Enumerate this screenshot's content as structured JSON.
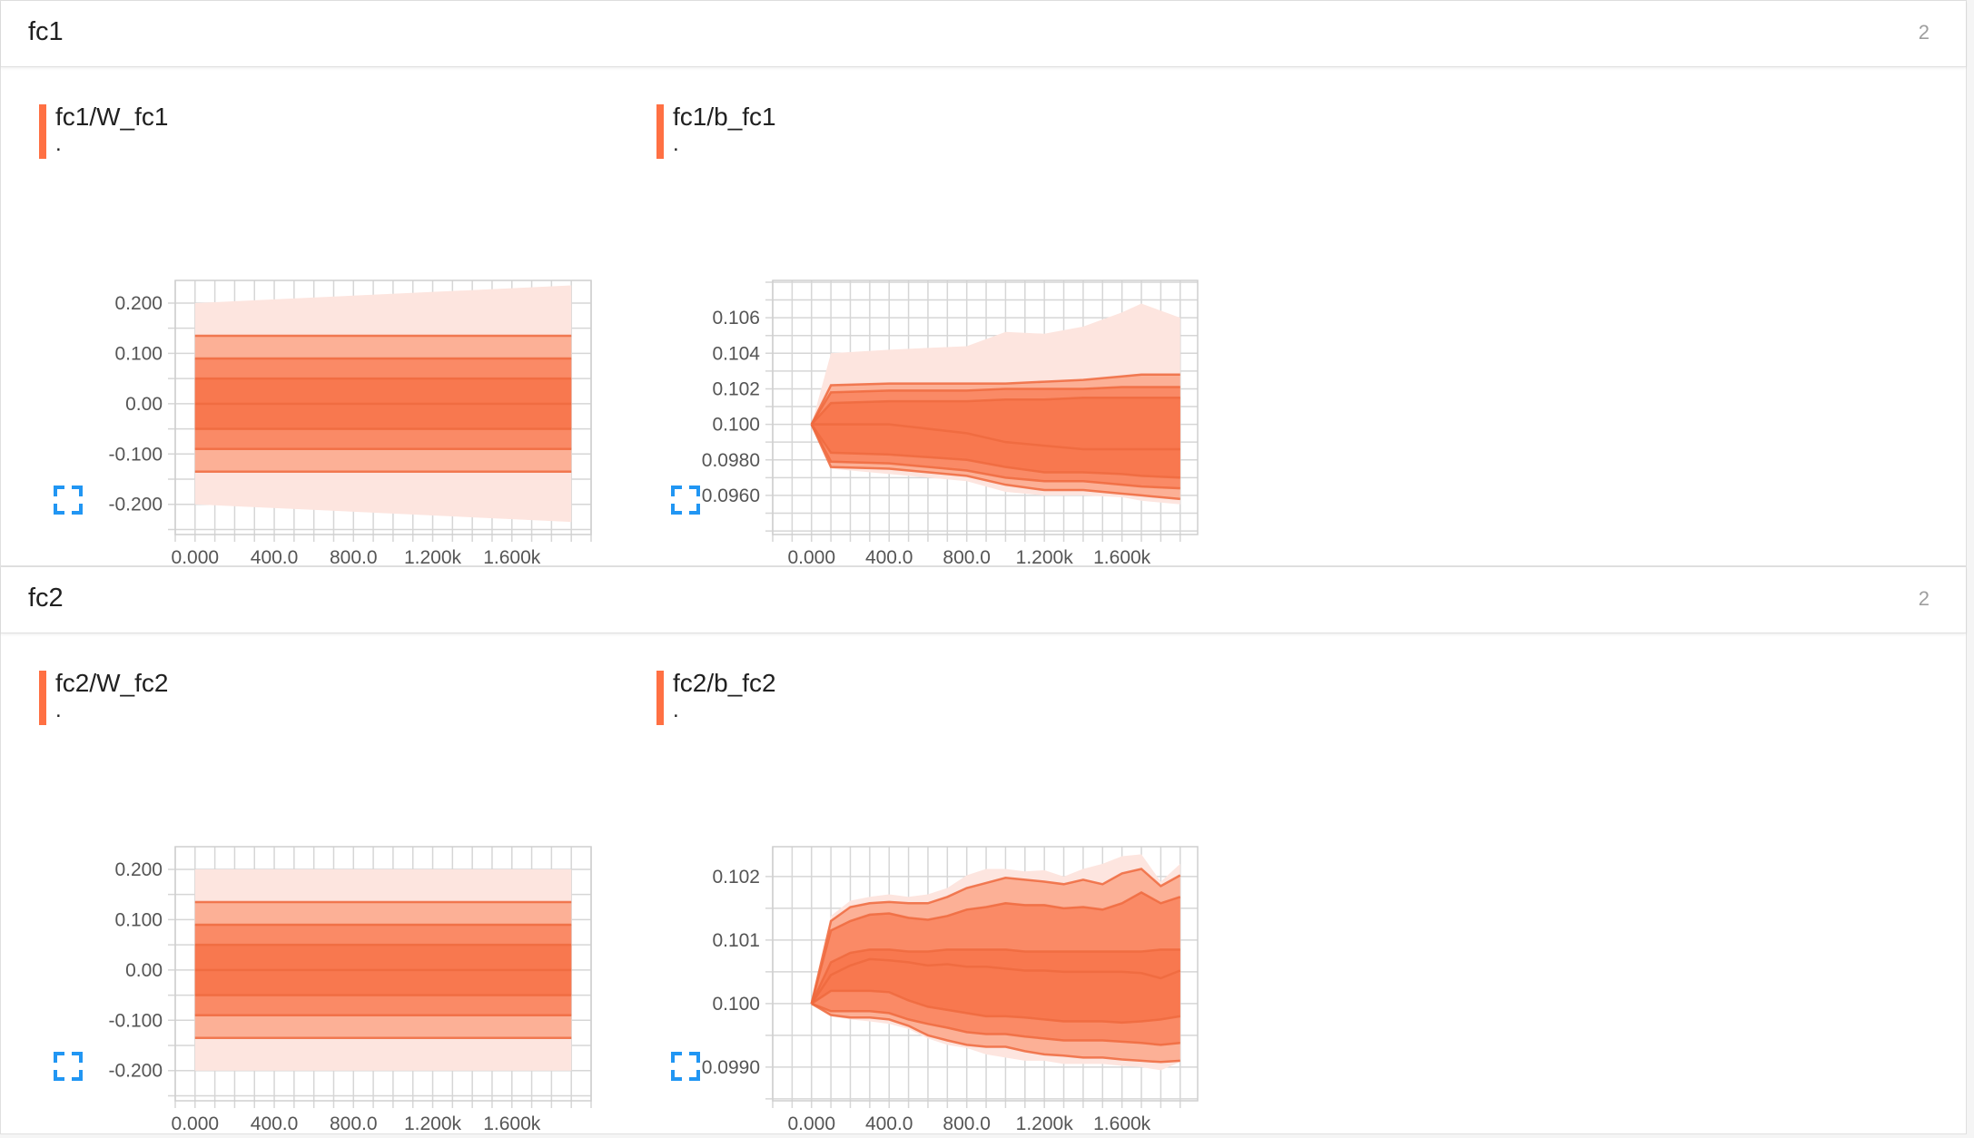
{
  "sections": [
    {
      "title": "fc1",
      "count": "2"
    },
    {
      "title": "fc2",
      "count": "2"
    }
  ],
  "colors": {
    "accent": "#ff7043",
    "band_outer": "#fde5df",
    "band_2": "#fcb096",
    "band_3": "#fa8a66",
    "band_inner": "#f8784f",
    "line": "#ef6a3e",
    "expand_icon": "#2196f3"
  },
  "icons": {
    "expand": "fullscreen-expand-icon"
  },
  "chart_data": [
    {
      "type": "area",
      "title": "fc1/W_fc1",
      "subtitle": ".",
      "ylim": [
        -0.26,
        0.245
      ],
      "xlim": [
        -100,
        2000
      ],
      "yticks": [
        0.2,
        0.1,
        0.0,
        -0.1,
        -0.2
      ],
      "ytick_labels": [
        "0.200",
        "0.100",
        "0.00",
        "-0.100",
        "-0.200"
      ],
      "xticks": [
        0,
        400,
        800,
        1200,
        1600
      ],
      "xtick_labels": [
        "0.000",
        "400.0",
        "800.0",
        "1.200k",
        "1.600k"
      ],
      "grid": true,
      "x": [
        0,
        1900
      ],
      "percentiles": [
        [
          -0.2,
          -0.235
        ],
        [
          -0.135,
          -0.135
        ],
        [
          -0.09,
          -0.09
        ],
        [
          -0.05,
          -0.05
        ],
        [
          0.0,
          0.0
        ],
        [
          0.05,
          0.05
        ],
        [
          0.09,
          0.09
        ],
        [
          0.135,
          0.135
        ],
        [
          0.2,
          0.235
        ]
      ]
    },
    {
      "type": "area",
      "title": "fc1/b_fc1",
      "subtitle": ".",
      "ylim": [
        0.0938,
        0.1081
      ],
      "xlim": [
        -200,
        1990
      ],
      "yticks": [
        0.106,
        0.104,
        0.102,
        0.1,
        0.098,
        0.096
      ],
      "ytick_labels": [
        "0.106",
        "0.104",
        "0.102",
        "0.100",
        "0.0980",
        "0.0960"
      ],
      "xticks": [
        0,
        400,
        800,
        1200,
        1600
      ],
      "xtick_labels": [
        "0.000",
        "400.0",
        "800.0",
        "1.200k",
        "1.600k"
      ],
      "grid": true,
      "x": [
        0,
        100,
        400,
        800,
        1000,
        1200,
        1400,
        1600,
        1700,
        1900
      ],
      "percentiles": [
        [
          0.1,
          0.0975,
          0.0972,
          0.0968,
          0.0962,
          0.096,
          0.096,
          0.0959,
          0.0957,
          0.0955
        ],
        [
          0.1,
          0.0976,
          0.0975,
          0.0971,
          0.0966,
          0.0963,
          0.0963,
          0.0961,
          0.096,
          0.0958
        ],
        [
          0.1,
          0.0979,
          0.0978,
          0.0974,
          0.097,
          0.0968,
          0.0968,
          0.0966,
          0.0965,
          0.0964
        ],
        [
          0.1,
          0.0984,
          0.0983,
          0.098,
          0.0976,
          0.0973,
          0.0973,
          0.0972,
          0.0971,
          0.097
        ],
        [
          0.1,
          0.1,
          0.1,
          0.0995,
          0.099,
          0.0988,
          0.0986,
          0.0986,
          0.0986,
          0.0986
        ],
        [
          0.1,
          0.1012,
          0.1013,
          0.1013,
          0.1014,
          0.1014,
          0.1015,
          0.1015,
          0.1015,
          0.1015
        ],
        [
          0.1,
          0.1018,
          0.1019,
          0.1019,
          0.102,
          0.102,
          0.102,
          0.1021,
          0.1021,
          0.1021
        ],
        [
          0.1,
          0.1022,
          0.1023,
          0.1023,
          0.1023,
          0.1024,
          0.1025,
          0.1027,
          0.1028,
          0.1028
        ],
        [
          0.1,
          0.104,
          0.1042,
          0.1044,
          0.1052,
          0.1051,
          0.1055,
          0.1063,
          0.1068,
          0.106
        ]
      ]
    },
    {
      "type": "area",
      "title": "fc2/W_fc2",
      "subtitle": ".",
      "ylim": [
        -0.26,
        0.245
      ],
      "xlim": [
        -100,
        2000
      ],
      "yticks": [
        0.2,
        0.1,
        0.0,
        -0.1,
        -0.2
      ],
      "ytick_labels": [
        "0.200",
        "0.100",
        "0.00",
        "-0.100",
        "-0.200"
      ],
      "xticks": [
        0,
        400,
        800,
        1200,
        1600
      ],
      "xtick_labels": [
        "0.000",
        "400.0",
        "800.0",
        "1.200k",
        "1.600k"
      ],
      "grid": true,
      "x": [
        0,
        1900
      ],
      "percentiles": [
        [
          -0.2,
          -0.2
        ],
        [
          -0.135,
          -0.135
        ],
        [
          -0.09,
          -0.09
        ],
        [
          -0.05,
          -0.05
        ],
        [
          0.0,
          0.0
        ],
        [
          0.05,
          0.05
        ],
        [
          0.09,
          0.09
        ],
        [
          0.135,
          0.135
        ],
        [
          0.2,
          0.2
        ]
      ]
    },
    {
      "type": "area",
      "title": "fc2/b_fc2",
      "subtitle": ".",
      "ylim": [
        0.09847,
        0.10247
      ],
      "xlim": [
        -200,
        1990
      ],
      "yticks": [
        0.102,
        0.101,
        0.1,
        0.099
      ],
      "ytick_labels": [
        "0.102",
        "0.101",
        "0.100",
        "0.0990"
      ],
      "xticks": [
        0,
        400,
        800,
        1200,
        1600
      ],
      "xtick_labels": [
        "0.000",
        "400.0",
        "800.0",
        "1.200k",
        "1.600k"
      ],
      "grid": true,
      "x": [
        0,
        100,
        200,
        300,
        400,
        500,
        600,
        700,
        800,
        900,
        1000,
        1100,
        1200,
        1300,
        1400,
        1500,
        1600,
        1700,
        1800,
        1900
      ],
      "percentiles": [
        [
          0.1,
          0.0998,
          0.09975,
          0.09972,
          0.09968,
          0.0996,
          0.09945,
          0.09935,
          0.0993,
          0.0992,
          0.09915,
          0.0991,
          0.0991,
          0.09905,
          0.09905,
          0.09905,
          0.09902,
          0.099,
          0.09895,
          0.09908
        ],
        [
          0.1,
          0.09982,
          0.09978,
          0.09978,
          0.09975,
          0.09965,
          0.0995,
          0.09942,
          0.09935,
          0.09932,
          0.09932,
          0.09925,
          0.0992,
          0.09918,
          0.09915,
          0.09915,
          0.09912,
          0.0991,
          0.09908,
          0.0991
        ],
        [
          0.1,
          0.09988,
          0.09988,
          0.09988,
          0.09985,
          0.09975,
          0.09968,
          0.09962,
          0.09955,
          0.09952,
          0.09952,
          0.09948,
          0.09945,
          0.09942,
          0.09942,
          0.09942,
          0.0994,
          0.09938,
          0.09935,
          0.09938
        ],
        [
          0.1,
          0.1002,
          0.1002,
          0.1002,
          0.10018,
          0.10005,
          0.09995,
          0.0999,
          0.09985,
          0.0998,
          0.0998,
          0.09978,
          0.09975,
          0.09972,
          0.09972,
          0.09972,
          0.0997,
          0.09972,
          0.09975,
          0.0998
        ],
        [
          0.1,
          0.10045,
          0.1006,
          0.1007,
          0.10068,
          0.10065,
          0.1006,
          0.10062,
          0.10058,
          0.10058,
          0.10055,
          0.10052,
          0.10052,
          0.1005,
          0.1005,
          0.1005,
          0.1005,
          0.10048,
          0.1004,
          0.10052
        ],
        [
          0.1,
          0.10065,
          0.1008,
          0.10085,
          0.10085,
          0.10082,
          0.10082,
          0.10085,
          0.10085,
          0.10085,
          0.10085,
          0.10082,
          0.10082,
          0.10082,
          0.10082,
          0.10082,
          0.10082,
          0.10082,
          0.10085,
          0.10085
        ],
        [
          0.1,
          0.10115,
          0.1013,
          0.1014,
          0.10142,
          0.10135,
          0.10132,
          0.10138,
          0.10148,
          0.10152,
          0.10158,
          0.10155,
          0.10155,
          0.1015,
          0.10152,
          0.10148,
          0.10158,
          0.10175,
          0.10158,
          0.10168
        ],
        [
          0.1,
          0.1013,
          0.10152,
          0.10158,
          0.1016,
          0.10158,
          0.10158,
          0.10168,
          0.10182,
          0.1019,
          0.10198,
          0.10195,
          0.10192,
          0.10188,
          0.10195,
          0.10188,
          0.10205,
          0.10212,
          0.10185,
          0.10202
        ],
        [
          0.1,
          0.10138,
          0.10162,
          0.10168,
          0.10172,
          0.10168,
          0.10172,
          0.10182,
          0.10202,
          0.10212,
          0.10212,
          0.10208,
          0.1021,
          0.102,
          0.10212,
          0.1022,
          0.10232,
          0.10235,
          0.10192,
          0.1022
        ]
      ]
    }
  ]
}
